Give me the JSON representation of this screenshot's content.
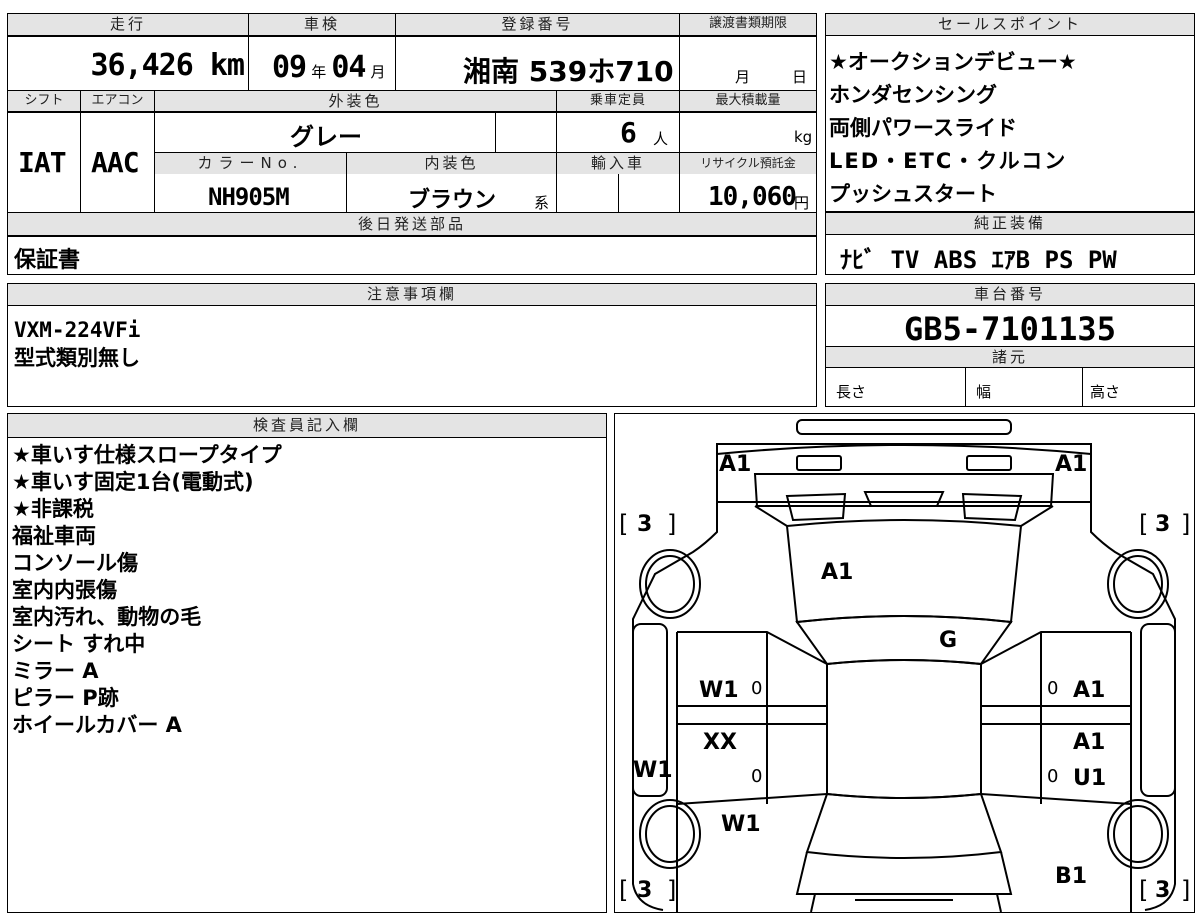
{
  "registration": {
    "mileage_label": "走行",
    "mileage_value": "36,426 km",
    "inspection_label": "車検",
    "inspection_year": "09",
    "inspection_year_unit": "年",
    "inspection_month": "04",
    "inspection_month_unit": "月",
    "plate_label": "登録番号",
    "plate_value": "湘南 539ホ710",
    "transfer_label": "譲渡書類期限",
    "transfer_month_unit": "月",
    "transfer_day_unit": "日"
  },
  "spec": {
    "shift_label": "シフト",
    "shift_value": "IAT",
    "aircon_label": "エアコン",
    "aircon_value": "AAC",
    "exterior_label": "外装色",
    "exterior_value": "グレー",
    "capacity_label": "乗車定員",
    "capacity_value": "6",
    "capacity_unit": "人",
    "maxload_label": "最大積載量",
    "maxload_unit": "kg",
    "color_no_label": "カラーNo.",
    "color_no_value": "NH905M",
    "interior_label": "内装色",
    "interior_value": "ブラウン",
    "interior_suffix": "系",
    "import_label": "輸入車",
    "recycle_label": "リサイクル預託金",
    "recycle_value": "10,060",
    "recycle_unit": "円"
  },
  "later_parts": {
    "label": "後日発送部品",
    "value": "保証書"
  },
  "sales_points": {
    "label": "セールスポイント",
    "items": [
      "★オークションデビュー★",
      "ホンダセンシング",
      "両側パワースライド",
      "LED・ETC・クルコン",
      "プッシュスタート"
    ]
  },
  "equipment": {
    "label": "純正装備",
    "value": "ﾅﾋﾞ TV ABS ｴｱB PS PW"
  },
  "notes": {
    "label": "注意事項欄",
    "lines": [
      "VXM-224VFi",
      "型式類別無し"
    ]
  },
  "chassis": {
    "label": "車台番号",
    "value": "GB5-7101135"
  },
  "dimensions": {
    "label": "諸元",
    "length": "長さ",
    "width": "幅",
    "height": "高さ"
  },
  "inspector": {
    "label": "検査員記入欄",
    "lines": [
      "★車いす仕様スロープタイプ",
      "★車いす固定1台(電動式)",
      "★非課税",
      "福祉車両",
      "コンソール傷",
      "室内内張傷",
      "室内汚れ、動物の毛",
      "シート すれ中",
      "ミラー A",
      "ピラー P跡",
      "ホイールカバー A"
    ]
  },
  "diagram": {
    "front_left": "A1",
    "front_right": "A1",
    "hood": "A1",
    "windshield": "G",
    "bracket_open": "[",
    "bracket_close": "]",
    "tire_tl": "3",
    "tire_tr": "3",
    "tire_bl": "3",
    "tire_br": "3",
    "left_front_door": "W1",
    "left_front_door_zero": "0",
    "left_rear_door": "XX",
    "left_rear_door_zero": "0",
    "left_side": "W1",
    "left_rear_quarter": "W1",
    "right_front_door_zero": "0",
    "right_front_door": "A1",
    "right_rear_door_a": "A1",
    "right_rear_door_zero": "0",
    "right_rear_door_u": "U1",
    "right_rear": "B1"
  }
}
